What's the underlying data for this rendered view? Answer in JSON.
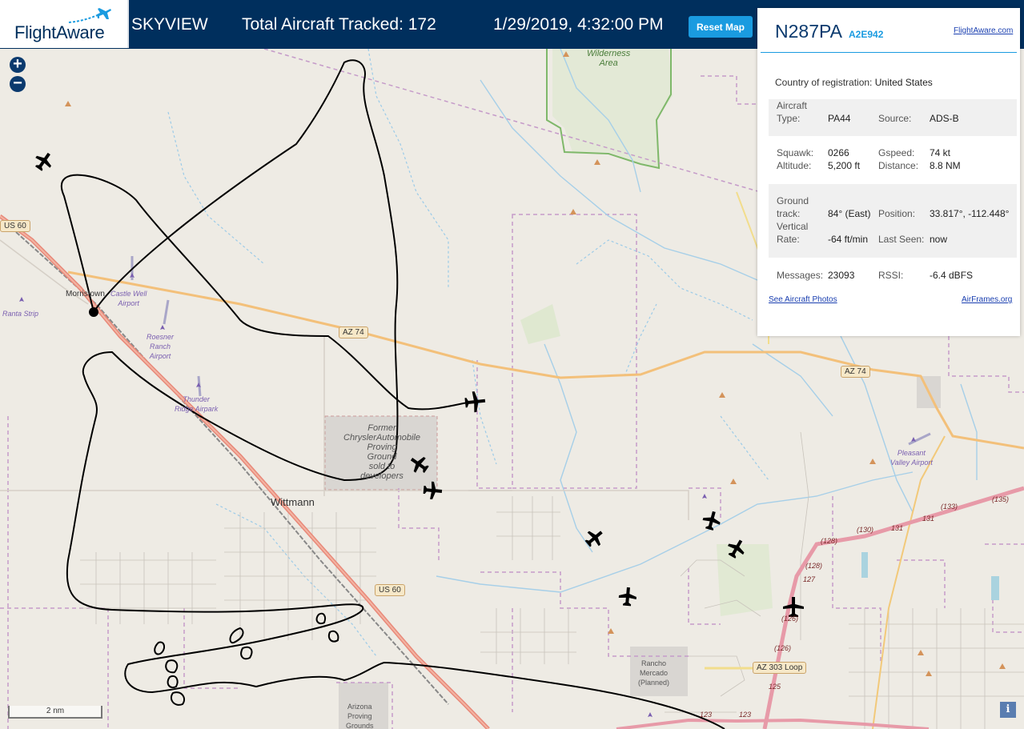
{
  "header": {
    "logo_text": "FlightAware",
    "app_title": "SKYVIEW",
    "tracked": "Total Aircraft Tracked: 172",
    "datetime": "1/29/2019, 4:32:00 PM",
    "reset_label": "Reset Map"
  },
  "map": {
    "zoom_in": "+",
    "zoom_out": "−",
    "scale": "2 nm",
    "info": "i",
    "labels": {
      "wilderness": "Wilderness\nArea",
      "us60_a": "US 60",
      "us60_b": "US 60",
      "az74_a": "AZ 74",
      "az74_b": "AZ 74",
      "az303": "AZ 303 Loop",
      "morristown": "Morristown",
      "wittmann": "Wittmann",
      "castle_well": "Castle Well\nAirport",
      "ranta": "Ranta Strip",
      "roesner": "Roesner\nRanch\nAirport",
      "thunder": "Thunder\nRidge Airpark",
      "chrysler": "Former\nChryslerAutomobile\nProving\nGround\nsold to\ndevelopers",
      "pleasant": "Pleasant\nValley Airport",
      "rancho": "Rancho\nMercado\n(Planned)",
      "arizona_pg": "Arizona\nProving\nGrounds"
    },
    "route_numbers": [
      "(133)",
      "(135)",
      "131",
      "(130)",
      "131",
      "(128)",
      "(128)",
      "127",
      "(126)",
      "(126)",
      "125",
      "123",
      "123"
    ]
  },
  "panel": {
    "registration": "N287PA",
    "hex": "A2E942",
    "fa_link": "FlightAware.com",
    "country_label": "Country of registration:",
    "country_value": "United States",
    "aircraft_type_label": "Aircraft\nType:",
    "aircraft_type_value": "PA44",
    "source_label": "Source:",
    "source_value": "ADS-B",
    "squawk_label": "Squawk:",
    "squawk_value": "0266",
    "gspeed_label": "Gspeed:",
    "gspeed_value": "74 kt",
    "altitude_label": "Altitude:",
    "altitude_value": "5,200 ft",
    "distance_label": "Distance:",
    "distance_value": "8.8 NM",
    "ground_track_label": "Ground\ntrack:",
    "ground_track_value": "84° (East)",
    "position_label": "Position:",
    "position_value": "33.817°, -112.448°",
    "vrate_label": "Vertical\nRate:",
    "vrate_value": "-64 ft/min",
    "lastseen_label": "Last Seen:",
    "lastseen_value": "now",
    "messages_label": "Messages:",
    "messages_value": "23093",
    "rssi_label": "RSSI:",
    "rssi_value": "-6.4 dBFS",
    "photos_link": "See Aircraft Photos",
    "airframes_link": "AirFrames.org"
  },
  "colors": {
    "header_bg": "#002f5d",
    "accent": "#1a9be0",
    "map_bg": "#eeebe4",
    "track": "#000000"
  }
}
